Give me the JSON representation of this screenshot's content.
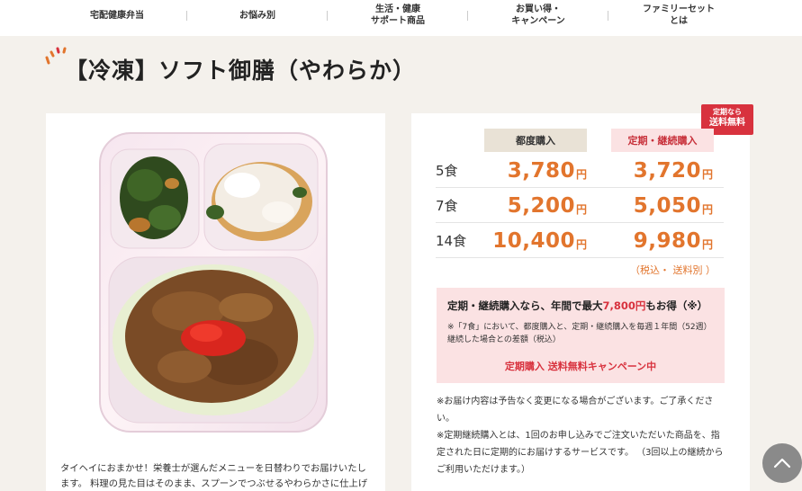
{
  "nav": {
    "items": [
      {
        "label": "宅配健康弁当"
      },
      {
        "label": "お悩み別"
      },
      {
        "label": "生活・健康\nサポート商品"
      },
      {
        "label": "お買い得・\nキャンペーン"
      },
      {
        "label": "ファミリーセット\nとは"
      }
    ]
  },
  "product": {
    "title": "【冷凍】ソフト御膳（やわらか）",
    "image_icon": "bento-tray-image",
    "description": "タイヘイにおまかせ！栄養士が選んだメニューを日替わりでお届けいたします。 料理の見た目はそのまま、スプーンでつぶせるやわらかさに仕上げまし"
  },
  "pricing": {
    "badge": {
      "line1": "定期なら",
      "line2": "送料無料"
    },
    "headers": {
      "regular": "都度購入",
      "subscription": "定期・継続購入"
    },
    "rows": [
      {
        "qty": "5食",
        "regular": "3,780",
        "subscription": "3,720"
      },
      {
        "qty": "7食",
        "regular": "5,200",
        "subscription": "5,050"
      },
      {
        "qty": "14食",
        "regular": "10,400",
        "subscription": "9,980"
      }
    ],
    "yen": "円",
    "tax_note": "（税込・ 送料別 ）",
    "promo": {
      "head_before": "定期・継続購入なら、年間で最大",
      "head_amount": "7,800円",
      "head_after": "もお得（※）",
      "note": "※「7食」において、都度購入と、定期・継続購入を毎週１年間（52週）継続した場合との差額（税込）",
      "campaign": "定期購入 送料無料キャンペーン中"
    },
    "notes": [
      "※お届け内容は予告なく変更になる場合がございます。ご了承ください。",
      "※定期継続購入とは、1回のお申し込みでご注文いただいた商品を、指定された日に定期的にお届けするサービスです。 （3回以上の継続からご利用いただけます。）"
    ]
  },
  "colors": {
    "accent_orange": "#e2752d",
    "accent_red": "#d8323e",
    "pink_bg": "#fbe2e3",
    "beige_header": "#e9e2d6",
    "page_bg": "#f4f1ec"
  },
  "scroll_top_icon": "chevron-up-icon"
}
